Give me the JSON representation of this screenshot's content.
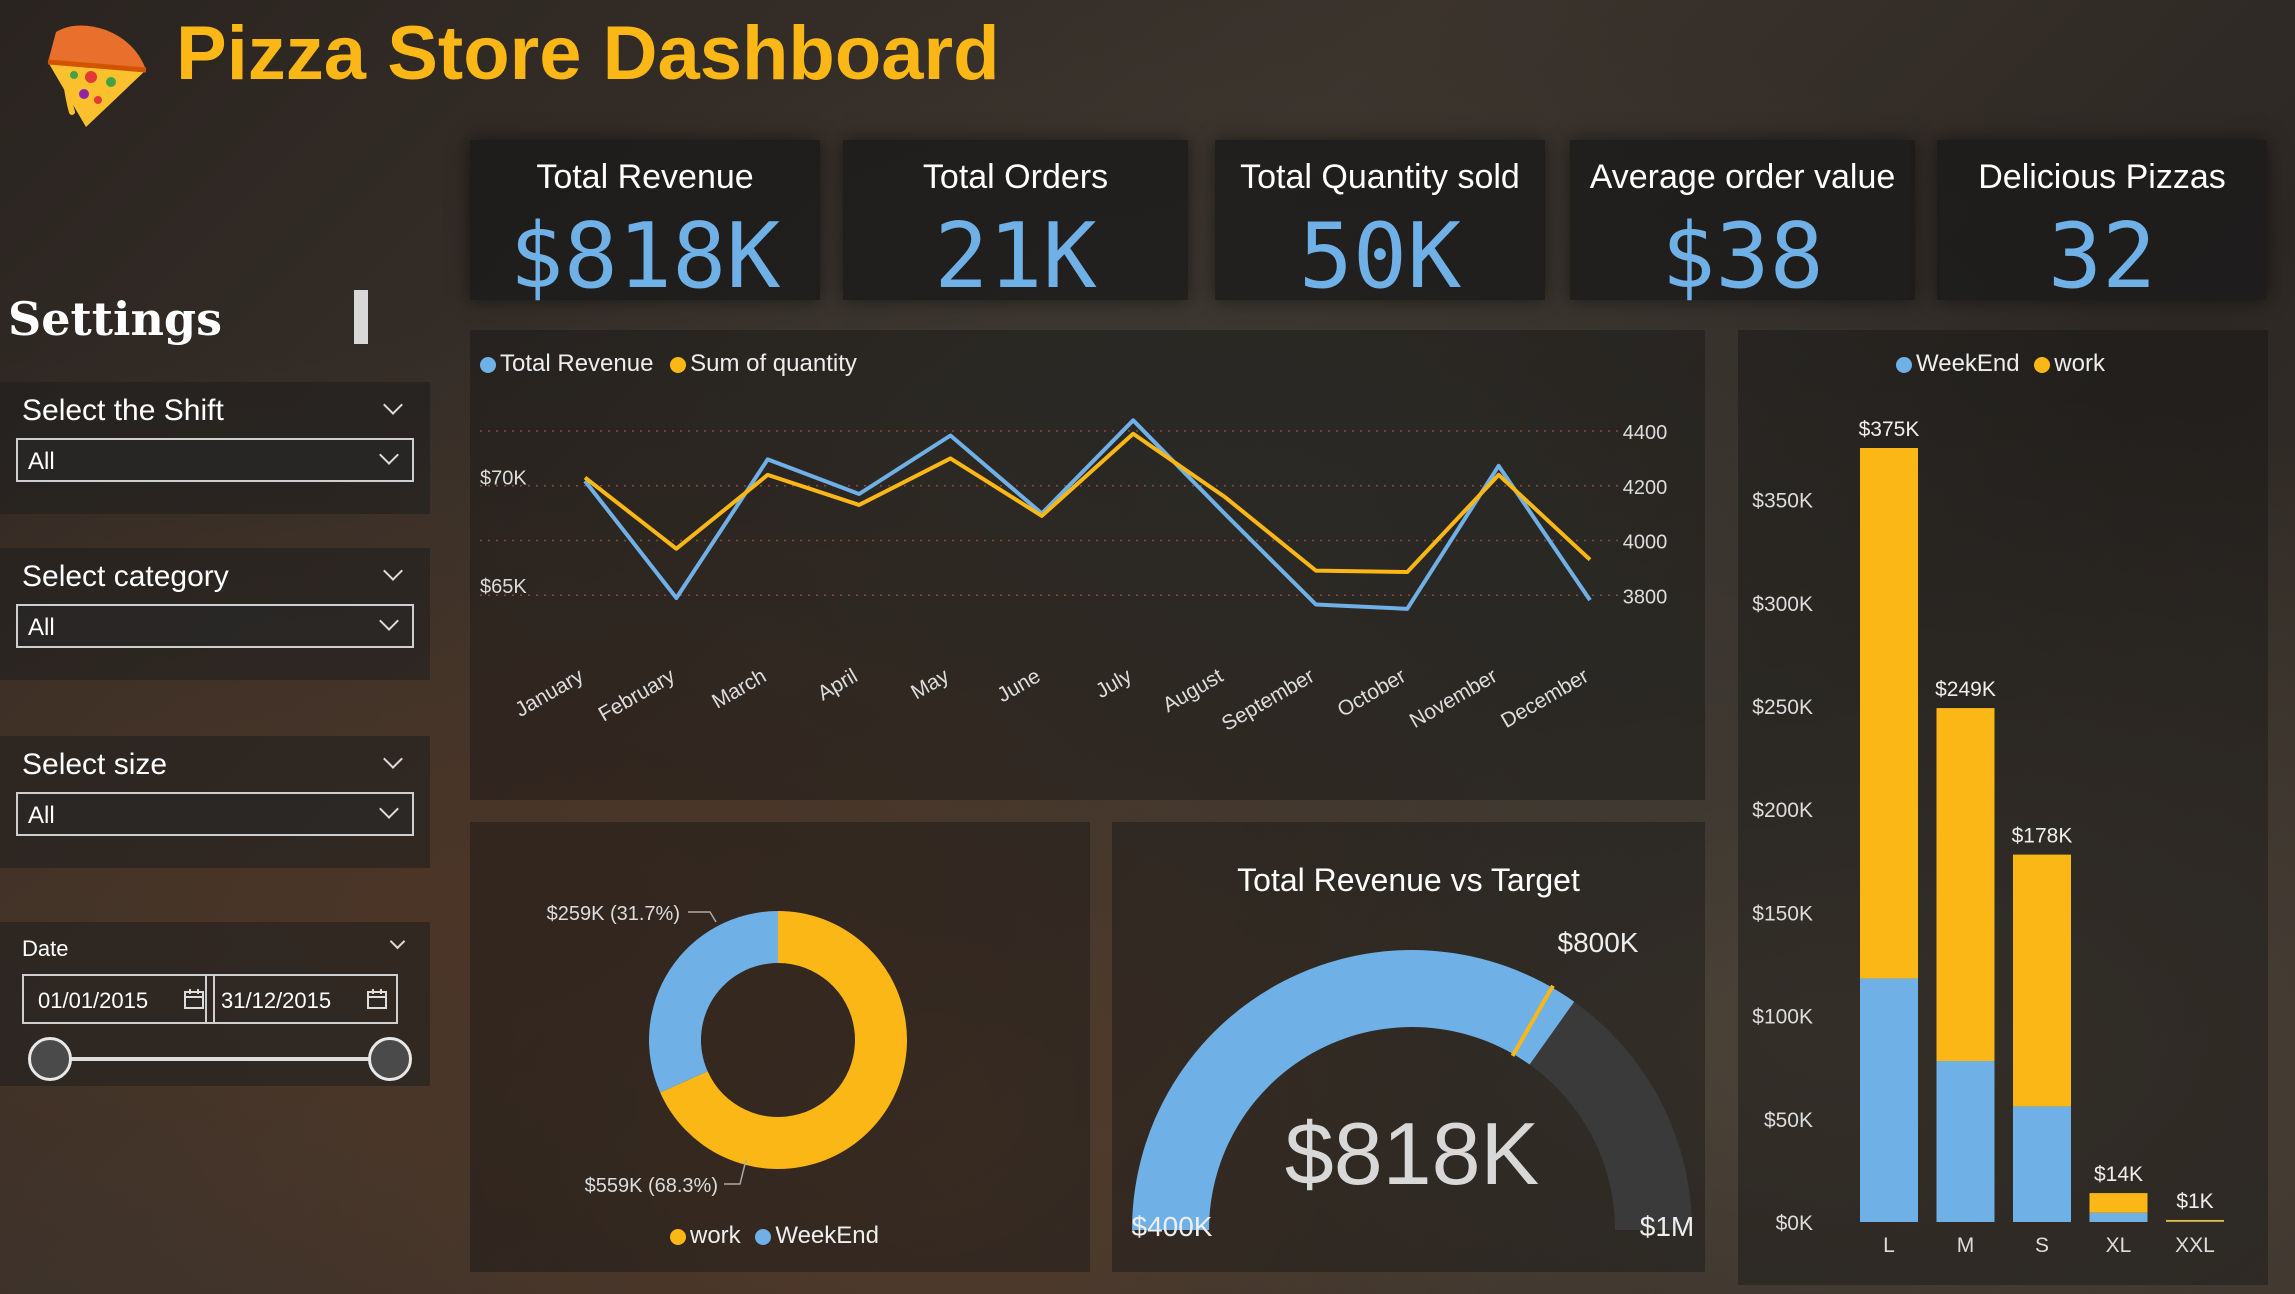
{
  "header": {
    "title": "Pizza Store Dashboard",
    "logo_icon": "pizza-slice-icon"
  },
  "kpis": [
    {
      "label": "Total Revenue",
      "value": "$818K"
    },
    {
      "label": "Total Orders",
      "value": "21K"
    },
    {
      "label": "Total Quantity sold",
      "value": "50K"
    },
    {
      "label": "Average order value",
      "value": "$38"
    },
    {
      "label": "Delicious Pizzas",
      "value": "32"
    }
  ],
  "settings": {
    "title": "Settings",
    "shift": {
      "label": "Select the Shift",
      "value": "All"
    },
    "category": {
      "label": "Select category",
      "value": "All"
    },
    "size": {
      "label": "Select size",
      "value": "All"
    },
    "date": {
      "label": "Date",
      "start": "01/01/2015",
      "end": "31/12/2015"
    }
  },
  "colors": {
    "blue": "#6fb0e6",
    "yellow": "#fbb715",
    "title": "#fbb715"
  },
  "chart_data": [
    {
      "type": "line",
      "legend": [
        "Total Revenue",
        "Sum of quantity"
      ],
      "categories": [
        "January",
        "February",
        "March",
        "April",
        "May",
        "June",
        "July",
        "August",
        "September",
        "October",
        "November",
        "December"
      ],
      "series": [
        {
          "name": "Total Revenue",
          "axis": "left",
          "values": [
            69800,
            64400,
            70800,
            69200,
            71900,
            68300,
            72600,
            68300,
            64100,
            63900,
            70500,
            64300
          ]
        },
        {
          "name": "Sum of quantity",
          "axis": "right",
          "values": [
            4230,
            3970,
            4240,
            4130,
            4300,
            4090,
            4390,
            4160,
            3890,
            3885,
            4240,
            3930
          ]
        }
      ],
      "left_ticks": [
        "$65K",
        "$70K"
      ],
      "left_tick_values": [
        65000,
        70000
      ],
      "right_ticks": [
        "3800",
        "4000",
        "4200",
        "4400"
      ],
      "right_tick_values": [
        3800,
        4000,
        4200,
        4400
      ],
      "ylim_left": [
        62000,
        74000
      ],
      "ylim_right": [
        3600,
        4550
      ]
    },
    {
      "type": "bar",
      "stacked": true,
      "legend": [
        "WeekEnd",
        "work"
      ],
      "categories": [
        "L",
        "M",
        "S",
        "XL",
        "XXL"
      ],
      "series": [
        {
          "name": "WeekEnd",
          "values": [
            118000,
            78000,
            56000,
            4500,
            300
          ]
        },
        {
          "name": "work",
          "values": [
            257000,
            171000,
            122000,
            9500,
            700
          ]
        }
      ],
      "totals": [
        "$375K",
        "$249K",
        "$178K",
        "$14K",
        "$1K"
      ],
      "y_ticks": [
        "$0K",
        "$50K",
        "$100K",
        "$150K",
        "$200K",
        "$250K",
        "$300K",
        "$350K"
      ],
      "y_tick_values": [
        0,
        50000,
        100000,
        150000,
        200000,
        250000,
        300000,
        350000
      ],
      "ylim": [
        0,
        375000
      ]
    },
    {
      "type": "pie",
      "donut": true,
      "legend": [
        "work",
        "WeekEnd"
      ],
      "slices": [
        {
          "name": "work",
          "value": 559,
          "label": "$559K (68.3%)"
        },
        {
          "name": "WeekEnd",
          "value": 259,
          "label": "$259K (31.7%)"
        }
      ]
    },
    {
      "type": "gauge",
      "title": "Total Revenue vs Target",
      "value": 818,
      "value_label": "$818K",
      "min": 400,
      "min_label": "$400K",
      "max": 1000,
      "max_label": "$1M",
      "target": 800,
      "target_label": "$800K"
    }
  ]
}
